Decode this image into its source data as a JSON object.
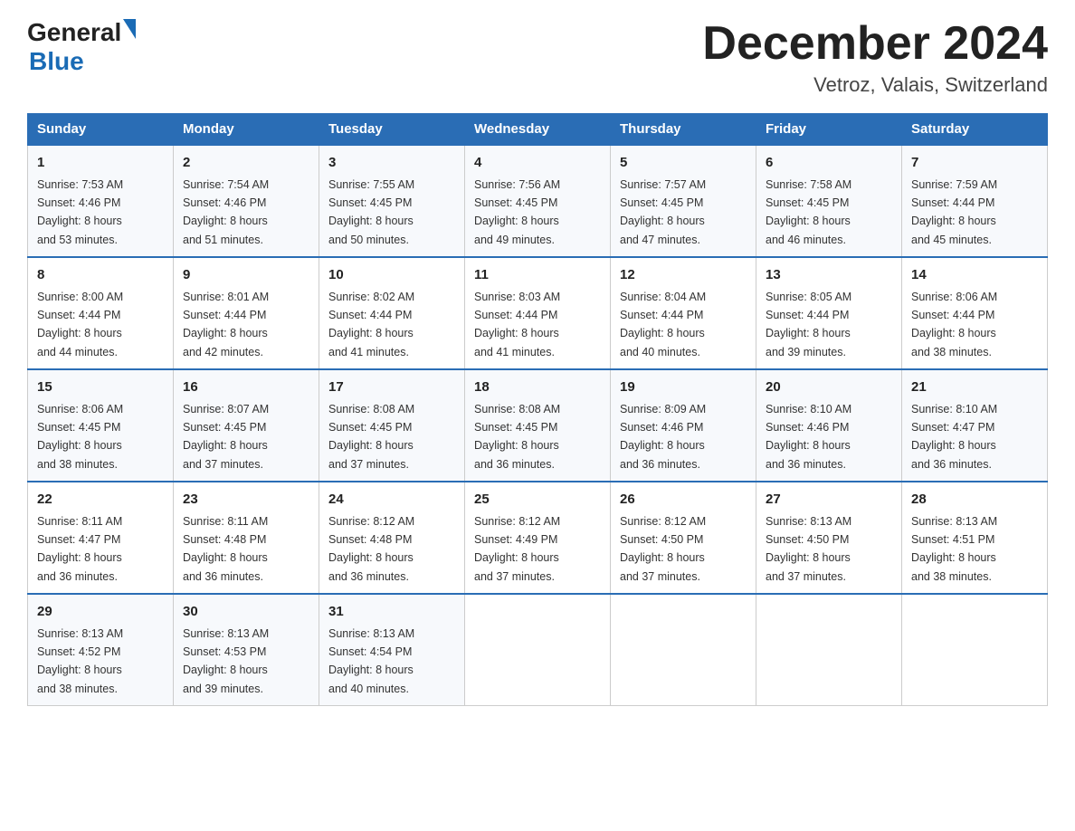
{
  "header": {
    "title": "December 2024",
    "subtitle": "Vetroz, Valais, Switzerland",
    "logo_general": "General",
    "logo_blue": "Blue"
  },
  "columns": [
    "Sunday",
    "Monday",
    "Tuesday",
    "Wednesday",
    "Thursday",
    "Friday",
    "Saturday"
  ],
  "weeks": [
    [
      {
        "day": "1",
        "sunrise": "Sunrise: 7:53 AM",
        "sunset": "Sunset: 4:46 PM",
        "daylight": "Daylight: 8 hours",
        "minutes": "and 53 minutes."
      },
      {
        "day": "2",
        "sunrise": "Sunrise: 7:54 AM",
        "sunset": "Sunset: 4:46 PM",
        "daylight": "Daylight: 8 hours",
        "minutes": "and 51 minutes."
      },
      {
        "day": "3",
        "sunrise": "Sunrise: 7:55 AM",
        "sunset": "Sunset: 4:45 PM",
        "daylight": "Daylight: 8 hours",
        "minutes": "and 50 minutes."
      },
      {
        "day": "4",
        "sunrise": "Sunrise: 7:56 AM",
        "sunset": "Sunset: 4:45 PM",
        "daylight": "Daylight: 8 hours",
        "minutes": "and 49 minutes."
      },
      {
        "day": "5",
        "sunrise": "Sunrise: 7:57 AM",
        "sunset": "Sunset: 4:45 PM",
        "daylight": "Daylight: 8 hours",
        "minutes": "and 47 minutes."
      },
      {
        "day": "6",
        "sunrise": "Sunrise: 7:58 AM",
        "sunset": "Sunset: 4:45 PM",
        "daylight": "Daylight: 8 hours",
        "minutes": "and 46 minutes."
      },
      {
        "day": "7",
        "sunrise": "Sunrise: 7:59 AM",
        "sunset": "Sunset: 4:44 PM",
        "daylight": "Daylight: 8 hours",
        "minutes": "and 45 minutes."
      }
    ],
    [
      {
        "day": "8",
        "sunrise": "Sunrise: 8:00 AM",
        "sunset": "Sunset: 4:44 PM",
        "daylight": "Daylight: 8 hours",
        "minutes": "and 44 minutes."
      },
      {
        "day": "9",
        "sunrise": "Sunrise: 8:01 AM",
        "sunset": "Sunset: 4:44 PM",
        "daylight": "Daylight: 8 hours",
        "minutes": "and 42 minutes."
      },
      {
        "day": "10",
        "sunrise": "Sunrise: 8:02 AM",
        "sunset": "Sunset: 4:44 PM",
        "daylight": "Daylight: 8 hours",
        "minutes": "and 41 minutes."
      },
      {
        "day": "11",
        "sunrise": "Sunrise: 8:03 AM",
        "sunset": "Sunset: 4:44 PM",
        "daylight": "Daylight: 8 hours",
        "minutes": "and 41 minutes."
      },
      {
        "day": "12",
        "sunrise": "Sunrise: 8:04 AM",
        "sunset": "Sunset: 4:44 PM",
        "daylight": "Daylight: 8 hours",
        "minutes": "and 40 minutes."
      },
      {
        "day": "13",
        "sunrise": "Sunrise: 8:05 AM",
        "sunset": "Sunset: 4:44 PM",
        "daylight": "Daylight: 8 hours",
        "minutes": "and 39 minutes."
      },
      {
        "day": "14",
        "sunrise": "Sunrise: 8:06 AM",
        "sunset": "Sunset: 4:44 PM",
        "daylight": "Daylight: 8 hours",
        "minutes": "and 38 minutes."
      }
    ],
    [
      {
        "day": "15",
        "sunrise": "Sunrise: 8:06 AM",
        "sunset": "Sunset: 4:45 PM",
        "daylight": "Daylight: 8 hours",
        "minutes": "and 38 minutes."
      },
      {
        "day": "16",
        "sunrise": "Sunrise: 8:07 AM",
        "sunset": "Sunset: 4:45 PM",
        "daylight": "Daylight: 8 hours",
        "minutes": "and 37 minutes."
      },
      {
        "day": "17",
        "sunrise": "Sunrise: 8:08 AM",
        "sunset": "Sunset: 4:45 PM",
        "daylight": "Daylight: 8 hours",
        "minutes": "and 37 minutes."
      },
      {
        "day": "18",
        "sunrise": "Sunrise: 8:08 AM",
        "sunset": "Sunset: 4:45 PM",
        "daylight": "Daylight: 8 hours",
        "minutes": "and 36 minutes."
      },
      {
        "day": "19",
        "sunrise": "Sunrise: 8:09 AM",
        "sunset": "Sunset: 4:46 PM",
        "daylight": "Daylight: 8 hours",
        "minutes": "and 36 minutes."
      },
      {
        "day": "20",
        "sunrise": "Sunrise: 8:10 AM",
        "sunset": "Sunset: 4:46 PM",
        "daylight": "Daylight: 8 hours",
        "minutes": "and 36 minutes."
      },
      {
        "day": "21",
        "sunrise": "Sunrise: 8:10 AM",
        "sunset": "Sunset: 4:47 PM",
        "daylight": "Daylight: 8 hours",
        "minutes": "and 36 minutes."
      }
    ],
    [
      {
        "day": "22",
        "sunrise": "Sunrise: 8:11 AM",
        "sunset": "Sunset: 4:47 PM",
        "daylight": "Daylight: 8 hours",
        "minutes": "and 36 minutes."
      },
      {
        "day": "23",
        "sunrise": "Sunrise: 8:11 AM",
        "sunset": "Sunset: 4:48 PM",
        "daylight": "Daylight: 8 hours",
        "minutes": "and 36 minutes."
      },
      {
        "day": "24",
        "sunrise": "Sunrise: 8:12 AM",
        "sunset": "Sunset: 4:48 PM",
        "daylight": "Daylight: 8 hours",
        "minutes": "and 36 minutes."
      },
      {
        "day": "25",
        "sunrise": "Sunrise: 8:12 AM",
        "sunset": "Sunset: 4:49 PM",
        "daylight": "Daylight: 8 hours",
        "minutes": "and 37 minutes."
      },
      {
        "day": "26",
        "sunrise": "Sunrise: 8:12 AM",
        "sunset": "Sunset: 4:50 PM",
        "daylight": "Daylight: 8 hours",
        "minutes": "and 37 minutes."
      },
      {
        "day": "27",
        "sunrise": "Sunrise: 8:13 AM",
        "sunset": "Sunset: 4:50 PM",
        "daylight": "Daylight: 8 hours",
        "minutes": "and 37 minutes."
      },
      {
        "day": "28",
        "sunrise": "Sunrise: 8:13 AM",
        "sunset": "Sunset: 4:51 PM",
        "daylight": "Daylight: 8 hours",
        "minutes": "and 38 minutes."
      }
    ],
    [
      {
        "day": "29",
        "sunrise": "Sunrise: 8:13 AM",
        "sunset": "Sunset: 4:52 PM",
        "daylight": "Daylight: 8 hours",
        "minutes": "and 38 minutes."
      },
      {
        "day": "30",
        "sunrise": "Sunrise: 8:13 AM",
        "sunset": "Sunset: 4:53 PM",
        "daylight": "Daylight: 8 hours",
        "minutes": "and 39 minutes."
      },
      {
        "day": "31",
        "sunrise": "Sunrise: 8:13 AM",
        "sunset": "Sunset: 4:54 PM",
        "daylight": "Daylight: 8 hours",
        "minutes": "and 40 minutes."
      },
      null,
      null,
      null,
      null
    ]
  ]
}
